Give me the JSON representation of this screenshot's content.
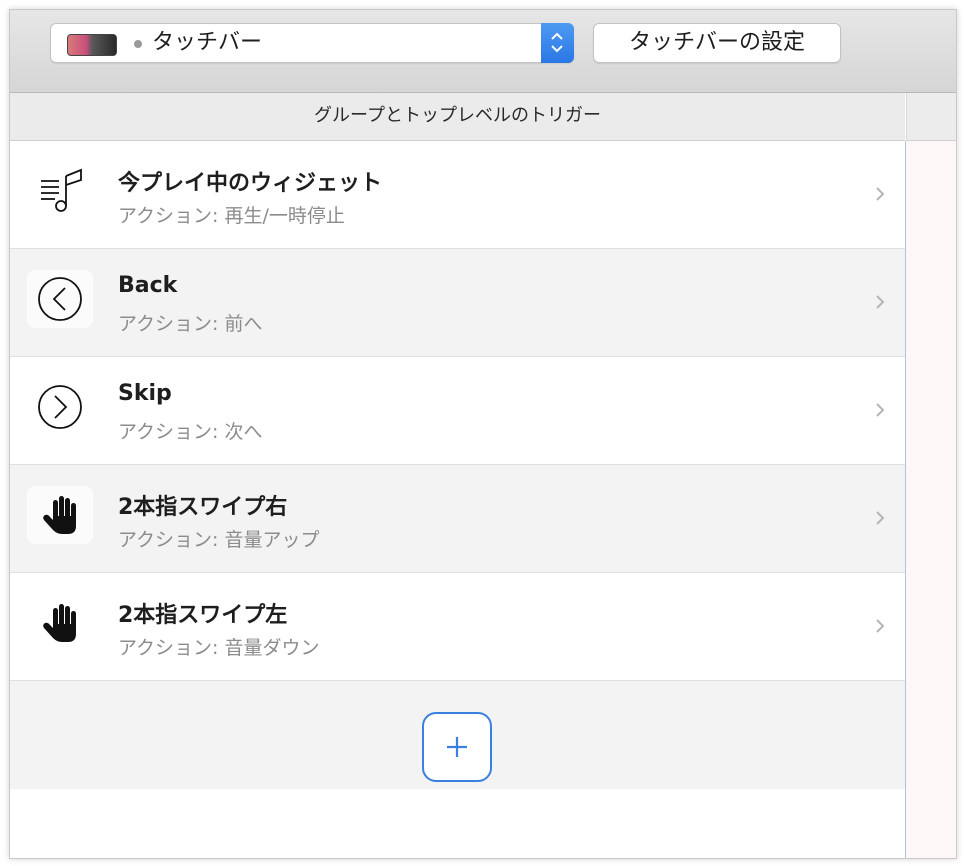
{
  "toolbar": {
    "selector_label": "タッチバー",
    "settings_label": "タッチバーの設定"
  },
  "table": {
    "header": "グループとトップレベルのトリガー"
  },
  "rows": [
    {
      "title": "今プレイ中のウィジェット",
      "action": "アクション: 再生/一時停止",
      "icon": "music-note-icon"
    },
    {
      "title": "Back",
      "action": "アクション: 前へ",
      "icon": "circle-chevron-left-icon"
    },
    {
      "title": "Skip",
      "action": "アクション: 次へ",
      "icon": "circle-chevron-right-icon"
    },
    {
      "title": "2本指スワイプ右",
      "action": "アクション: 音量アップ",
      "icon": "hand-icon"
    },
    {
      "title": "2本指スワイプ左",
      "action": "アクション: 音量ダウン",
      "icon": "hand-icon"
    }
  ],
  "colors": {
    "accent": "#2a77e6",
    "add_button_border": "#3a80e0"
  }
}
